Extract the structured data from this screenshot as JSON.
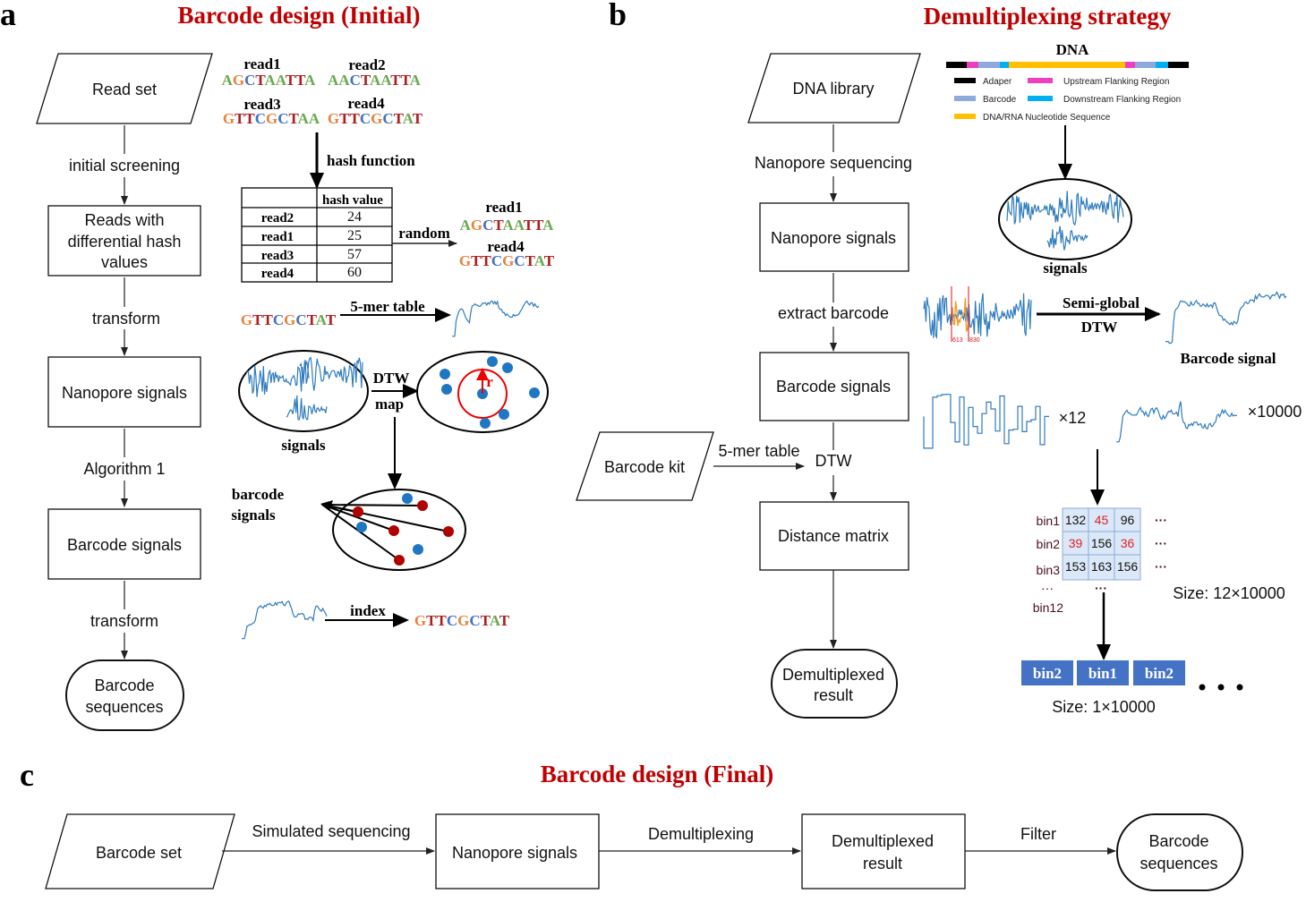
{
  "colors": {
    "title": "#c00000",
    "A": "#6aa84f",
    "G": "#e8823a",
    "C": "#4472c4",
    "T": "#b01c1c",
    "signal": "#2f7cbf",
    "adapter": "#000000",
    "upstream": "#ee3fc2",
    "barcode": "#8eaadb",
    "downstream": "#00b0f0",
    "sequence": "#ffc000",
    "bin_box": "#4472c4",
    "red_dot": "#b00000",
    "blue_dot": "#1f77c4"
  },
  "panel_a": {
    "letter": "a",
    "title": "Barcode design (Initial)",
    "flow": {
      "read_set": "Read set",
      "step1": "initial screening",
      "box1": [
        "Reads with",
        "differential hash",
        "values"
      ],
      "step2": "transform",
      "box2": "Nanopore signals",
      "step3": "Algorithm 1",
      "box3": "Barcode signals",
      "step4": "transform",
      "end": [
        "Barcode",
        "sequences"
      ]
    },
    "reads": [
      {
        "name": "read1",
        "seq": "AGCTAATTA"
      },
      {
        "name": "read2",
        "seq": "AACTAATTA"
      },
      {
        "name": "read3",
        "seq": "GTTCGCTAA"
      },
      {
        "name": "read4",
        "seq": "GTTCGCTAT"
      }
    ],
    "hash_label": "hash function",
    "table": {
      "header": "hash value",
      "rows": [
        {
          "read": "read2",
          "value": "24"
        },
        {
          "read": "read1",
          "value": "25"
        },
        {
          "read": "read3",
          "value": "57"
        },
        {
          "read": "read4",
          "value": "60"
        }
      ]
    },
    "random_label": "random",
    "selected": [
      {
        "name": "read1",
        "seq": "AGCTAATTA"
      },
      {
        "name": "read4",
        "seq": "GTTCGCTAT"
      }
    ],
    "kmer_seq": "GTTCGCTAT",
    "kmer_label": "5-mer table",
    "signals_label": "signals",
    "dtw_label": "DTW",
    "map_label": "map",
    "r_label": "r",
    "barcode_signals_label": [
      "barcode",
      "signals"
    ],
    "index_label": "index",
    "index_seq": "GTTCGCTAT"
  },
  "panel_b": {
    "letter": "b",
    "title": "Demultiplexing strategy",
    "flow": {
      "library": "DNA library",
      "step1": "Nanopore sequencing",
      "box1": "Nanopore signals",
      "step2": "extract barcode",
      "box2": "Barcode signals",
      "step3": "DTW",
      "kit": "Barcode kit",
      "kit_step": "5-mer table",
      "box3": "Distance matrix",
      "end": [
        "Demultiplexed",
        "result"
      ]
    },
    "dna": {
      "title": "DNA",
      "legend": [
        {
          "label": "Adaper",
          "color": "#000000"
        },
        {
          "label": "Upstream Flanking Region",
          "color": "#ee3fc2"
        },
        {
          "label": "Barcode",
          "color": "#8eaadb"
        },
        {
          "label": "Downstream Flanking Region",
          "color": "#00b0f0"
        },
        {
          "label": "DNA/RNA Nucleotide Sequence",
          "color": "#ffc000"
        }
      ]
    },
    "signals_label": "signals",
    "region_marks": [
      "613",
      "830"
    ],
    "semi_global": "Semi-global",
    "dtw": "DTW",
    "barcode_signal_label": "Barcode signal",
    "times12": "×12",
    "times10000": "×10000",
    "matrix": {
      "rows": [
        {
          "bin": "bin1",
          "values": [
            "132",
            "45",
            "96"
          ],
          "red": [
            1
          ]
        },
        {
          "bin": "bin2",
          "values": [
            "39",
            "156",
            "36"
          ],
          "red": [
            0,
            2
          ]
        },
        {
          "bin": "bin3",
          "values": [
            "153",
            "163",
            "156"
          ],
          "red": []
        }
      ],
      "ellipsis": "···",
      "last_bin": "bin12",
      "size": "Size: 12×10000"
    },
    "result_bins": [
      "bin2",
      "bin1",
      "bin2"
    ],
    "result_size": "Size: 1×10000"
  },
  "panel_c": {
    "letter": "c",
    "title": "Barcode design (Final)",
    "flow": {
      "start": "Barcode set",
      "step1": "Simulated sequencing",
      "box1": "Nanopore signals",
      "step2": "Demultiplexing",
      "box2": [
        "Demultiplexed",
        "result"
      ],
      "step3": "Filter",
      "end": [
        "Barcode",
        "sequences"
      ]
    }
  }
}
